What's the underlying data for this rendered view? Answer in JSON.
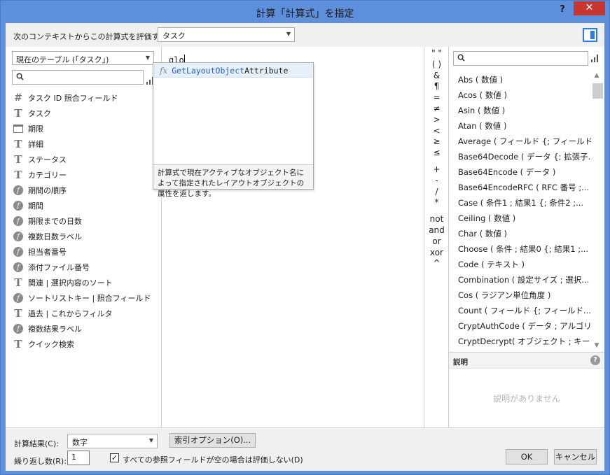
{
  "window": {
    "title": "計算「計算式」を指定",
    "help": "?",
    "close": "✕"
  },
  "context": {
    "label": "次のコンテキストからこの計算式を評価する(E):",
    "value": "タスク"
  },
  "left": {
    "table_select": "現在のテーブル (「タスク」)",
    "search_placeholder": "",
    "fields": [
      {
        "icon": "hash",
        "name": "タスク ID 照合フィールド"
      },
      {
        "icon": "text",
        "name": "タスク"
      },
      {
        "icon": "date",
        "name": "期限"
      },
      {
        "icon": "text",
        "name": "詳細"
      },
      {
        "icon": "text",
        "name": "ステータス"
      },
      {
        "icon": "text",
        "name": "カテゴリー"
      },
      {
        "icon": "calc",
        "name": "期間の順序"
      },
      {
        "icon": "calc",
        "name": "期間"
      },
      {
        "icon": "calc",
        "name": "期限までの日数"
      },
      {
        "icon": "calc",
        "name": "複数日数ラベル"
      },
      {
        "icon": "calc",
        "name": "担当者番号"
      },
      {
        "icon": "calc",
        "name": "添付ファイル番号"
      },
      {
        "icon": "text",
        "name": "関連 | 選択内容のソート"
      },
      {
        "icon": "calc",
        "name": "ソートリストキー | 照合フィールド"
      },
      {
        "icon": "text",
        "name": "過去 | これからフィルタ"
      },
      {
        "icon": "calc",
        "name": "複数結果ラベル"
      },
      {
        "icon": "text",
        "name": "クイック検索"
      }
    ]
  },
  "formula": {
    "text": "glo",
    "autocomplete": {
      "fx": "fx",
      "match": "GetLayoutObject",
      "rest": "Attribute",
      "description": "計算式で現在アクティブなオブジェクト名によって指定されたレイアウトオブジェクトの属性を返します。"
    }
  },
  "operators": [
    "\" \"",
    "( )",
    "&",
    "¶",
    "=",
    "≠",
    ">",
    "<",
    "≥",
    "≤",
    "",
    "+",
    "-",
    "/",
    "*",
    "",
    "not",
    "and",
    "or",
    "xor",
    "^"
  ],
  "functions": {
    "search_placeholder": "",
    "items": [
      "Abs ( 数値 )",
      "Acos ( 数値 )",
      "Asin ( 数値 )",
      "Atan ( 数値 )",
      "Average ( フィールド {; フィールド...} )",
      "Base64Decode ( データ {; 拡張子...",
      "Base64Encode ( データ )",
      "Base64EncodeRFC ( RFC 番号 ;...",
      "Case ( 条件1 ; 結果1 {; 条件2 ;...",
      "Ceiling ( 数値 )",
      "Char ( 数値 )",
      "Choose ( 条件 ; 結果0 {; 結果1 ;...",
      "Code ( テキスト )",
      "Combination ( 設定サイズ ; 選択...",
      "Cos ( ラジアン単位角度 )",
      "Count ( フィールド {; フィールド...} )",
      "CryptAuthCode ( データ ; アルゴリズ...",
      "CryptDecrypt( オブジェクト ; キー )"
    ],
    "description_title": "説明",
    "description_empty": "説明がありません"
  },
  "bottom": {
    "result_label": "計算結果(C):",
    "result_value": "数字",
    "index_button": "索引オプション(O)...",
    "repeat_label": "繰り返し数(R):",
    "repeat_value": "1",
    "checkbox_label": "すべての参照フィールドが空の場合は評価しない(D)",
    "checkbox_checked": "✓",
    "ok": "OK",
    "cancel": "キャンセル"
  }
}
